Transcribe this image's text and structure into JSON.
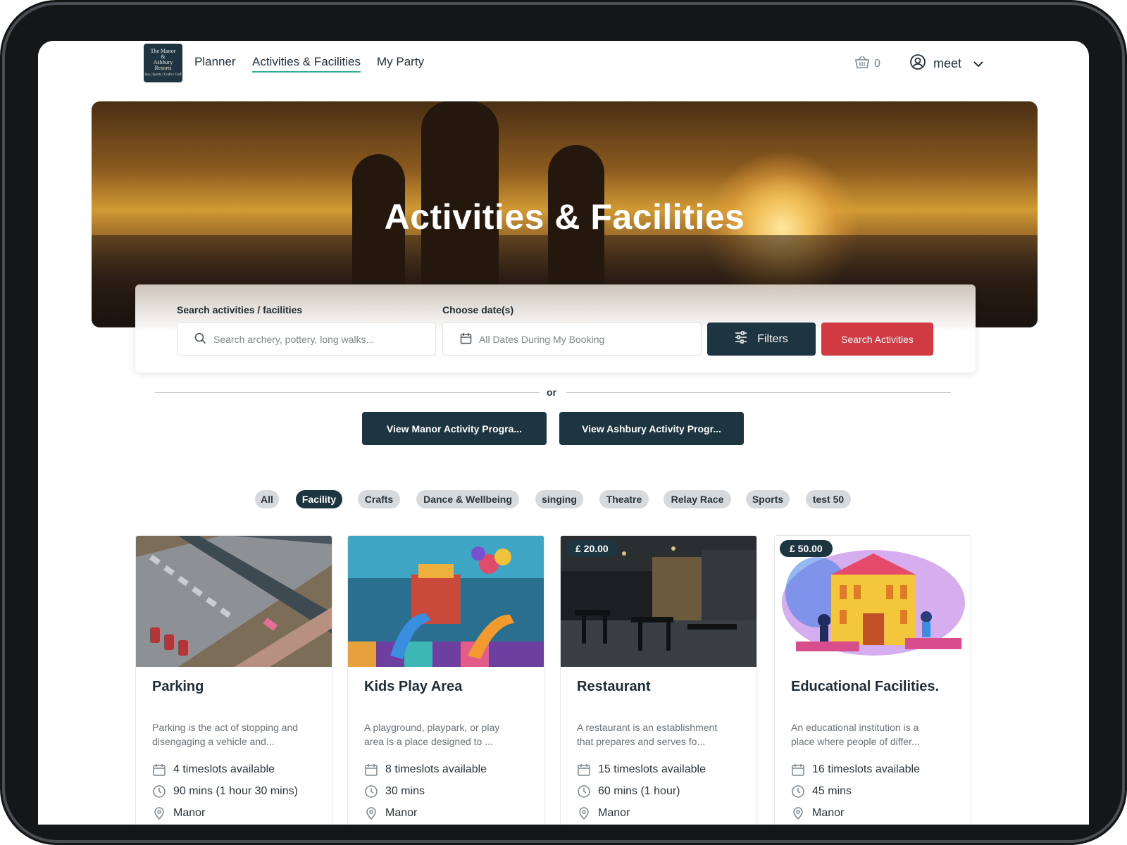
{
  "nav": {
    "logo_lines": [
      "The Manor",
      "&",
      "Ashbury",
      "Resorts"
    ],
    "logo_tagline": "Spa | Sports | Crafts | Golf",
    "links": [
      "Planner",
      "Activities & Facilities",
      "My Party"
    ],
    "basket_count": "0",
    "user_name": "meet"
  },
  "hero": {
    "title": "Activities & Facilities"
  },
  "search": {
    "activity_label": "Search activities / facilities",
    "activity_placeholder": "Search archery, pottery, long walks...",
    "date_label": "Choose date(s)",
    "date_value": "All Dates During My Booking",
    "filters_label": "Filters",
    "search_button": "Search Activities"
  },
  "divider_text": "or",
  "program_buttons": [
    "View Manor Activity Progra...",
    "View Ashbury Activity Progr..."
  ],
  "categories": [
    {
      "label": "All",
      "active": false
    },
    {
      "label": "Facility",
      "active": true
    },
    {
      "label": "Crafts",
      "active": false
    },
    {
      "label": "Dance & Wellbeing",
      "active": false
    },
    {
      "label": "singing",
      "active": false
    },
    {
      "label": "Theatre",
      "active": false
    },
    {
      "label": "Relay Race",
      "active": false
    },
    {
      "label": "Sports",
      "active": false
    },
    {
      "label": "test 50",
      "active": false
    }
  ],
  "cards": [
    {
      "title": "Parking",
      "price": "",
      "desc_line1": "Parking is the act of stopping and",
      "desc_line2": "disengaging a vehicle and...",
      "timeslots": "4 timeslots available",
      "duration": "90 mins (1 hour 30 mins)",
      "location": "Manor",
      "image": "aerial-parking-lot"
    },
    {
      "title": "Kids Play Area",
      "price": "",
      "desc_line1": "A playground, playpark, or play",
      "desc_line2": "area is a place designed to ...",
      "timeslots": "8 timeslots available",
      "duration": "30 mins",
      "location": "Manor",
      "image": "indoor-playground"
    },
    {
      "title": "Restaurant",
      "price": "£ 20.00",
      "desc_line1": "A restaurant is an establishment",
      "desc_line2": "that prepares and serves fo...",
      "timeslots": "15 timeslots available",
      "duration": "60 mins (1 hour)",
      "location": "Manor",
      "image": "restaurant-interior"
    },
    {
      "title": "Educational Facilities.",
      "price": "£ 50.00",
      "desc_line1": "An educational institution is a",
      "desc_line2": "place where people of differ...",
      "timeslots": "16 timeslots available",
      "duration": "45 mins",
      "location": "Manor",
      "image": "school-illustration"
    }
  ],
  "colors": {
    "primary_dark": "#1d3441",
    "accent_red": "#d23a43",
    "accent_teal": "#2fae96"
  }
}
